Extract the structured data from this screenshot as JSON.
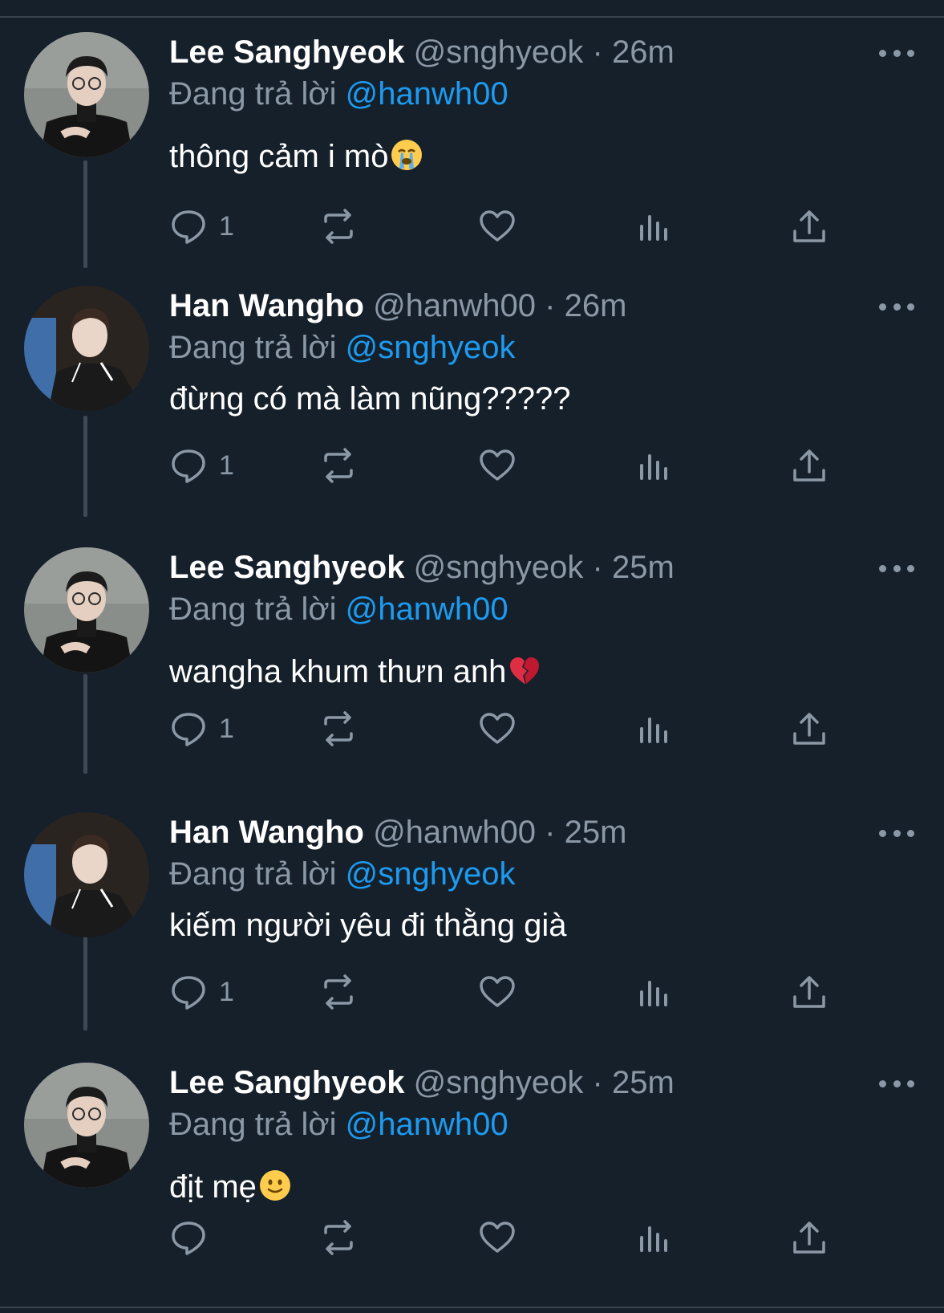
{
  "colors": {
    "background": "#15202b",
    "secondary_text": "#8b98a5",
    "link": "#1d9bf0",
    "divider": "#38444d"
  },
  "tweets": [
    {
      "name": "Lee Sanghyeok",
      "handle": "@snghyeok",
      "separator": "·",
      "time": "26m",
      "reply_prefix": "Đang trả lời",
      "mention": "@hanwh00",
      "text": "thông cảm i mò",
      "emoji": "loudly-crying-face-emoji",
      "reply_count": "1",
      "avatar": "lee-avatar"
    },
    {
      "name": "Han Wangho",
      "handle": "@hanwh00",
      "separator": "·",
      "time": "26m",
      "reply_prefix": "Đang trả lời",
      "mention": "@snghyeok",
      "text": "đừng có mà làm nũng?????",
      "emoji": "",
      "reply_count": "1",
      "avatar": "han-avatar"
    },
    {
      "name": "Lee Sanghyeok",
      "handle": "@snghyeok",
      "separator": "·",
      "time": "25m",
      "reply_prefix": "Đang trả lời",
      "mention": "@hanwh00",
      "text": "wangha khum thưn anh",
      "emoji": "broken-heart-emoji",
      "reply_count": "1",
      "avatar": "lee-avatar"
    },
    {
      "name": "Han Wangho",
      "handle": "@hanwh00",
      "separator": "·",
      "time": "25m",
      "reply_prefix": "Đang trả lời",
      "mention": "@snghyeok",
      "text": "kiếm người yêu đi thằng già",
      "emoji": "",
      "reply_count": "1",
      "avatar": "han-avatar"
    },
    {
      "name": "Lee Sanghyeok",
      "handle": "@snghyeok",
      "separator": "·",
      "time": "25m",
      "reply_prefix": "Đang trả lời",
      "mention": "@hanwh00",
      "text": "địt mẹ",
      "emoji": "slightly-smiling-face-emoji",
      "reply_count": "",
      "avatar": "lee-avatar"
    }
  ]
}
